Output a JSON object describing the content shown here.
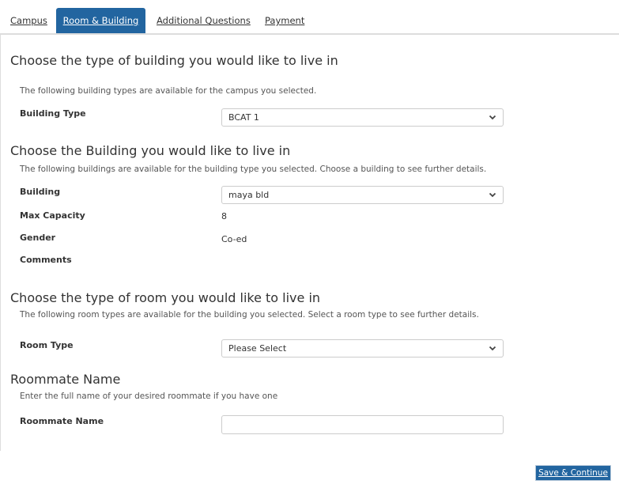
{
  "tabs": [
    {
      "label": "Campus",
      "active": false
    },
    {
      "label": "Room & Building",
      "active": true
    },
    {
      "label": "Additional Questions",
      "active": false
    },
    {
      "label": "Payment",
      "active": false
    }
  ],
  "building_type_section": {
    "heading": "Choose the type of building you would like to live in",
    "description": "The following building types are available for the campus you selected.",
    "field_label": "Building Type",
    "selected": "BCAT 1"
  },
  "building_section": {
    "heading": "Choose the Building you would like to live in",
    "description": "The following buildings are available for the building type you selected. Choose a building to see further details.",
    "field_label": "Building",
    "selected": "maya bld",
    "details": [
      {
        "label": "Max Capacity",
        "value": "8"
      },
      {
        "label": "Gender",
        "value": "Co-ed"
      },
      {
        "label": "Comments",
        "value": ""
      }
    ]
  },
  "room_type_section": {
    "heading": "Choose the type of room you would like to live in",
    "description": "The following room types are available for the building you selected. Select a room type to see further details.",
    "field_label": "Room Type",
    "selected": "Please Select"
  },
  "roommate_section": {
    "heading": "Roommate Name",
    "description": "Enter the full name of your desired roommate if you have one",
    "field_label": "Roommate Name",
    "value": "",
    "placeholder": ""
  },
  "footer": {
    "save_label": "Save & Continue"
  },
  "colors": {
    "accent": "#2265a0",
    "border": "#dddddd"
  }
}
